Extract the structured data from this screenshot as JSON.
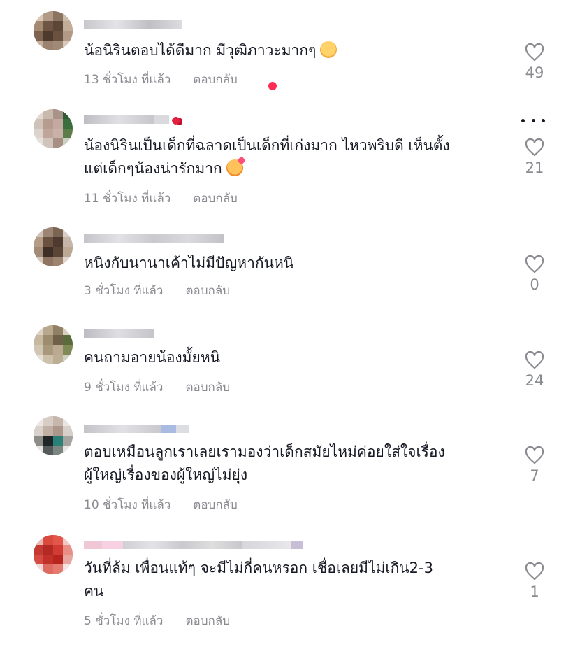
{
  "colors": {
    "text": "#161823",
    "muted": "#8a8b91",
    "badge": "#fe2c55"
  },
  "icons": {
    "like": "heart-outline-icon",
    "more": "more-dots-icon"
  },
  "comments": [
    {
      "text": "น้อนิรินตอบได้ดีมาก มีวุฒิภาวะมากๆ",
      "emoji": "smile-emoji",
      "time": "13 ชั่วโมง ที่แล้ว",
      "reply_label": "ตอบกลับ",
      "likes": "49"
    },
    {
      "text": "น้องนิรินเป็นเด็กที่ฉลาดเป็นเด็กที่เก่งมาก ไหวพริบดี เห็นตั้ง\nแต่เด็กๆน้องน่ารักมาก",
      "emoji": "smiling-face-with-hearts-emoji",
      "time": "11 ชั่วโมง ที่แล้ว",
      "reply_label": "ตอบกลับ",
      "likes": "21"
    },
    {
      "text": "หนิงกับนานาเค้าไม่มีปัญหากันหนิ",
      "time": "3 ชั่วโมง ที่แล้ว",
      "reply_label": "ตอบกลับ",
      "likes": "0"
    },
    {
      "text": "คนถามอายน้องมั้ยหนิ",
      "time": "9 ชั่วโมง ที่แล้ว",
      "reply_label": "ตอบกลับ",
      "likes": "24"
    },
    {
      "text": "ตอบเหมือนลูกเราเลยเรามองว่าเด็กสมัยไหม่ค่อยใส่ใจเรื่อง\nผู้ใหญ่เรื่องของผู้ใหญ่ไม่ยุ่ง",
      "time": "10 ชั่วโมง ที่แล้ว",
      "reply_label": "ตอบกลับ",
      "likes": "7"
    },
    {
      "text": "วันที่ล้ม เพื่อนแท้ๆ จะมีไม่กี่คนหรอก เชื่อเลยมีไม่เกิน2-3\nคน",
      "time": "5 ชั่วโมง ที่แล้ว",
      "reply_label": "ตอบกลับ",
      "likes": "1"
    }
  ]
}
